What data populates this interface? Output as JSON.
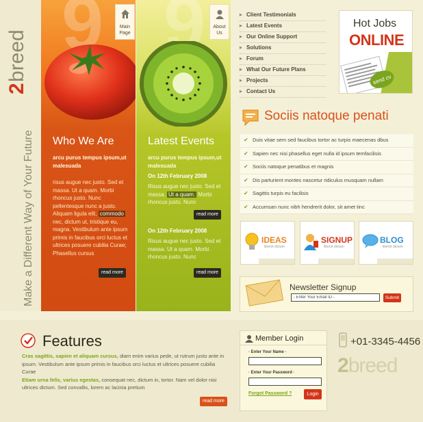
{
  "brand": {
    "logo_number": "2",
    "logo_text": "breed",
    "tagline": "Make a Different Way of Your Future"
  },
  "tabs": {
    "main_page": "Main Page",
    "about_us": "About Us"
  },
  "who_we_are": {
    "big_number": "9",
    "title": "Who We Are",
    "subtitle": "arcu purus tempus ipsum,ut malesuada",
    "text_before": "risus augue nec justo. Sed et massa. Ut a quam. Morbi rhoncus justo. Nunc pellentesque nunc a justo. Aliquam ligula elit,",
    "text_highlight": "commodo",
    "text_after": "nec, dictum ut, tristique eu, magna. Vestibulum ante ipsum primis in faucibus orci luctus et ultrices posuere cubilia Curae; Phasellus cursus",
    "read_more": "read more"
  },
  "latest_events": {
    "big_number": "9",
    "title": "Latest Events",
    "subtitle": "arcu purus tempus ipsum,ut malesuada",
    "events": [
      {
        "date": "On 12th February 2008",
        "text_before": "Risus augue nec justo. Sed et massa.",
        "text_highlight": "Ut a quam.",
        "text_after": "Morbi rhoncus justo. Nunc",
        "read_more": "read more"
      },
      {
        "date": "On 12th February 2008",
        "text": "Risus augue nec justo. Sed et massa. Ut a quam. Morbi rhoncus justo. Nunc",
        "read_more": "read more"
      }
    ]
  },
  "nav": {
    "items": [
      "Client Testimonials",
      "Latest Events",
      "Our Online Support",
      "Solutions",
      "Forum",
      "What Our Future Plans",
      "Projects",
      "Contact Us"
    ]
  },
  "hot_jobs": {
    "line1": "Hot Jobs",
    "line2": "ONLINE",
    "badge": "send cv"
  },
  "socii": {
    "title": "Sociis natoque penati",
    "items": [
      "Duis vitae sem sed faucibus tortor ac turpis maecenas dbus",
      "Sapien nec nisi phasellus eget nulla id ipsum temfacilisis",
      "Sociis natoque penatibus et magnis",
      "Dis parturient montes nascetur ridiculus musquam nullam",
      "Sagittis turpis eu facilisis",
      "Accumsan nunc nibh hendrerit dolor, sit amet tinc"
    ]
  },
  "cards": [
    {
      "label": "IDEAS",
      "sub": "liberot dictum",
      "color": "#e8841f"
    },
    {
      "label": "SIGNUP",
      "sub": "liberot dictum",
      "color": "#d2351a"
    },
    {
      "label": "BLOG",
      "sub": "liberot dictum",
      "color": "#2a8fd0"
    }
  ],
  "newsletter": {
    "title": "Newsletter Signup",
    "input_value": "- Enter Your Email ID -",
    "submit": "Submit"
  },
  "features": {
    "title": "Features",
    "p1_lead": "Cras sagittis, sapien et aliquam cursus,",
    "p1_text": "diam enim varius pede, ut rutrum justo ante in ipsum. Vestibulum ante ipsum primis in faucibus orci luctus et ultrices posuere cubilia Curae",
    "p2_lead": "Etiam urna felis, varius egestas,",
    "p2_text": "consequat nec, dictum in, tortor. Nam vel dolor nisi ultrices dictum. Sed convallis, lorem ac lacinia pretium",
    "read_more": "read more"
  },
  "member_login": {
    "title": "Member Login",
    "name_label": "· Enter Your Name ·",
    "password_label": "· Enter Your Password ·",
    "forgot": "Forgot Password ?",
    "login": "Login"
  },
  "contact": {
    "phone": "+01-3345-4456",
    "brand_number": "2",
    "brand_text": "breed"
  },
  "colors": {
    "accent_orange": "#d8521b",
    "accent_green": "#7aa51f",
    "accent_red": "#d2351a"
  }
}
